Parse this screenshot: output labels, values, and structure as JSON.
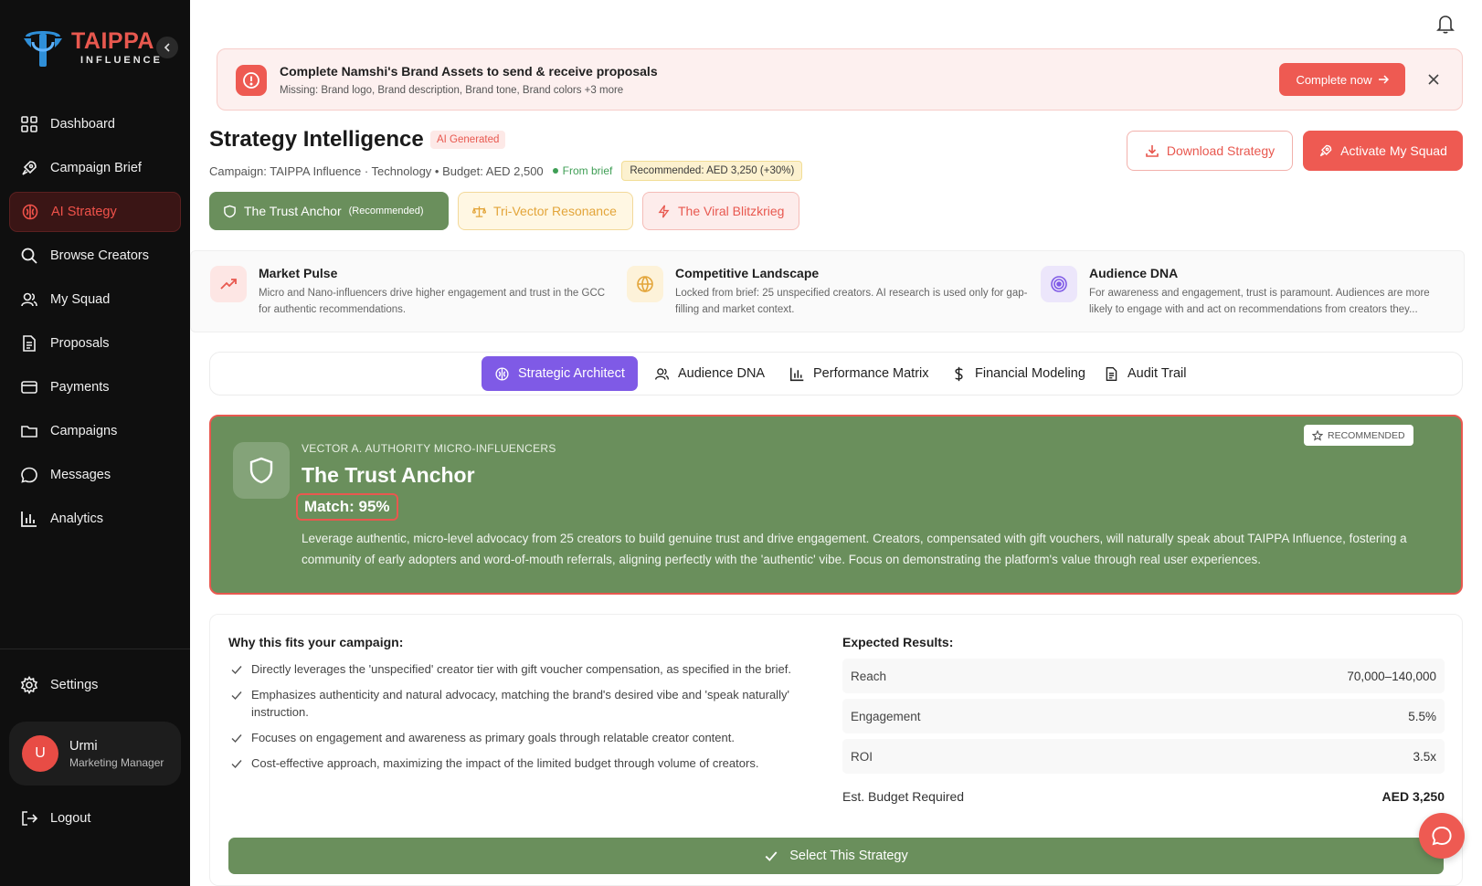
{
  "brand": {
    "name": "TAIPPA",
    "sub": "INFLUENCE",
    "accent": "#e8584f"
  },
  "sidebar": {
    "items": [
      {
        "label": "Dashboard",
        "icon": "grid-icon"
      },
      {
        "label": "Campaign Brief",
        "icon": "rocket-icon"
      },
      {
        "label": "AI Strategy",
        "icon": "brain-icon",
        "active": true
      },
      {
        "label": "Browse Creators",
        "icon": "search-icon"
      },
      {
        "label": "My Squad",
        "icon": "users-icon"
      },
      {
        "label": "Proposals",
        "icon": "document-icon"
      },
      {
        "label": "Payments",
        "icon": "credit-card-icon"
      },
      {
        "label": "Campaigns",
        "icon": "folder-icon"
      },
      {
        "label": "Messages",
        "icon": "chat-icon"
      },
      {
        "label": "Analytics",
        "icon": "bar-chart-icon"
      }
    ],
    "settings_label": "Settings",
    "user": {
      "initial": "U",
      "name": "Urmi",
      "role": "Marketing Manager"
    },
    "logout_label": "Logout"
  },
  "alert": {
    "title": "Complete Namshi's Brand Assets to send & receive proposals",
    "subtitle": "Missing: Brand logo, Brand description, Brand tone, Brand colors +3 more",
    "button_label": "Complete now"
  },
  "header": {
    "title": "Strategy Intelligence",
    "badge": "AI Generated",
    "meta": "Campaign: TAIPPA Influence · Technology • Budget: AED 2,500",
    "from_brief": "From brief",
    "recommended": "Recommended: AED 3,250 (+30%)",
    "download_label": "Download Strategy",
    "activate_label": "Activate My Squad"
  },
  "strategy_tabs": [
    {
      "label": "The Trust Anchor",
      "suffix": "(Recommended)"
    },
    {
      "label": "Tri-Vector Resonance"
    },
    {
      "label": "The Viral Blitzkrieg"
    }
  ],
  "insights": [
    {
      "title": "Market Pulse",
      "text": "Micro and Nano-influencers drive higher engagement and trust in the GCC for authentic recommendations."
    },
    {
      "title": "Competitive Landscape",
      "text": "Locked from brief: 25 unspecified creators. AI research is used only for gap-filling and market context."
    },
    {
      "title": "Audience DNA",
      "text": "For awareness and engagement, trust is paramount. Audiences are more likely to engage with and act on recommendations from creators they..."
    }
  ],
  "view_tabs": [
    {
      "label": "Strategic Architect",
      "active": true
    },
    {
      "label": "Audience DNA"
    },
    {
      "label": "Performance Matrix"
    },
    {
      "label": "Financial Modeling"
    },
    {
      "label": "Audit Trail"
    }
  ],
  "hero": {
    "vector": "VECTOR A. AUTHORITY MICRO-INFLUENCERS",
    "title": "The Trust Anchor",
    "match": "Match: 95%",
    "badge": "RECOMMENDED",
    "description": "Leverage authentic, micro-level advocacy from 25 creators to build genuine trust and drive engagement. Creators, compensated with gift vouchers, will naturally speak about TAIPPA Influence, fostering a community of early adopters and word-of-mouth referrals, aligning perfectly with the 'authentic' vibe. Focus on demonstrating the platform's value through real user experiences."
  },
  "details": {
    "why_title": "Why this fits your campaign:",
    "why_items": [
      "Directly leverages the 'unspecified' creator tier with gift voucher compensation, as specified in the brief.",
      "Emphasizes authenticity and natural advocacy, matching the brand's desired vibe and 'speak naturally' instruction.",
      "Focuses on engagement and awareness as primary goals through relatable creator content.",
      "Cost-effective approach, maximizing the impact of the limited budget through volume of creators."
    ],
    "expected_title": "Expected Results:",
    "results": [
      {
        "label": "Reach",
        "value": "70,000–140,000"
      },
      {
        "label": "Engagement",
        "value": "5.5%"
      },
      {
        "label": "ROI",
        "value": "3.5x"
      }
    ],
    "budget": {
      "label": "Est. Budget Required",
      "value": "AED 3,250"
    },
    "select_label": "Select This Strategy"
  }
}
